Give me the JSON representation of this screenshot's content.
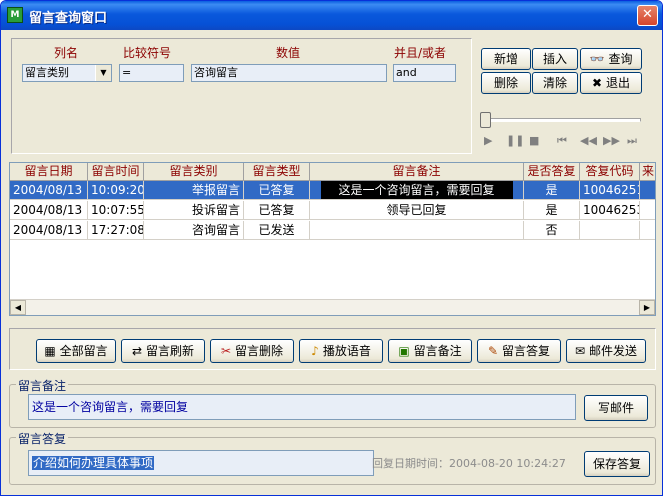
{
  "window": {
    "title": "留言查询窗口",
    "app_icon": "app-icon",
    "close_symbol": "✕"
  },
  "query": {
    "headers": {
      "column": "列名",
      "compare": "比较符号",
      "value": "数值",
      "logic": "并且/或者"
    },
    "column_value": "留言类别",
    "compare_value": "=",
    "value_value": "咨询留言",
    "logic_value": "and"
  },
  "buttons": {
    "add": "新增",
    "insert": "插入",
    "search": "查询",
    "delete": "删除",
    "clear": "清除",
    "exit": "退出"
  },
  "media": {
    "play": "▶",
    "pause": "❚❚",
    "stop": "■",
    "first": "⏮",
    "rewind": "◀◀",
    "forward": "▶▶",
    "last": "⏭"
  },
  "grid": {
    "columns": [
      "留言日期",
      "留言时间",
      "留言类别",
      "留言类型",
      "留言备注",
      "是否答复",
      "答复代码",
      "来"
    ],
    "rows": [
      [
        "2004/08/13",
        "10:09:20",
        "举报留言",
        "已答复",
        "这是一个咨询留言，需要回复",
        "是",
        "10046251",
        ""
      ],
      [
        "2004/08/13",
        "10:07:55",
        "投诉留言",
        "已答复",
        "领导已回复",
        "是",
        "10046253",
        ""
      ],
      [
        "2004/08/13",
        "17:27:08",
        "咨询留言",
        "已发送",
        "",
        "否",
        "",
        ""
      ]
    ]
  },
  "actions": {
    "all": "全部留言",
    "refresh": "留言刷新",
    "remove": "留言删除",
    "play_voice": "播放语音",
    "note": "留言备注",
    "reply": "留言答复",
    "mail": "邮件发送"
  },
  "note_box": {
    "title": "留言备注",
    "text": "这是一个咨询留言，需要回复",
    "button": "写邮件"
  },
  "reply_box": {
    "title": "留言答复",
    "text": "介绍如何办理具体事项",
    "date_label": "回复日期时间：2004-08-20 10:24:27",
    "button": "保存答复"
  }
}
